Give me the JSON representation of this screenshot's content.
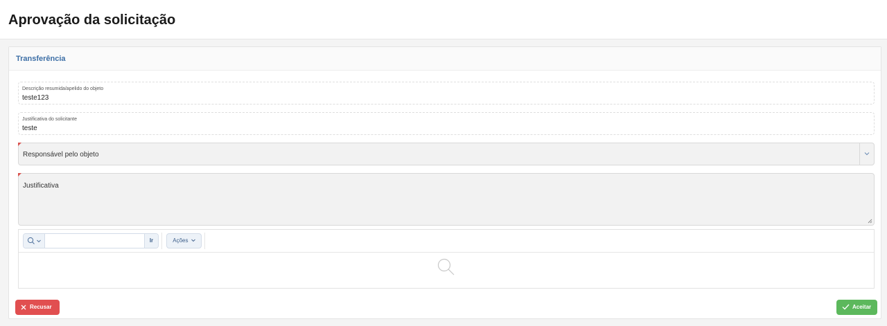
{
  "page": {
    "title": "Aprovação da solicitação"
  },
  "region": {
    "title": "Transferência",
    "fields": {
      "descricao": {
        "label": "Descrição resumida/apelido do objeto",
        "value": "teste123"
      },
      "justificativa_solicitante": {
        "label": "Justificativa do solicitante",
        "value": "teste"
      },
      "responsavel": {
        "label": "Responsável pelo objeto"
      },
      "justificativa": {
        "label": "Justificativa"
      }
    },
    "grid": {
      "search_placeholder": "",
      "go_label": "Ir",
      "actions_label": "Ações"
    },
    "buttons": {
      "reject_label": "Recusar",
      "accept_label": "Aceitar"
    }
  },
  "colors": {
    "title_accent": "#3d6fa6",
    "reject": "#e14f50",
    "accept": "#5cb85c",
    "required_marker": "#d9534f"
  },
  "icons": [
    "search-icon",
    "chevron-down-icon",
    "close-icon",
    "check-icon",
    "magnifier-empty-icon"
  ]
}
